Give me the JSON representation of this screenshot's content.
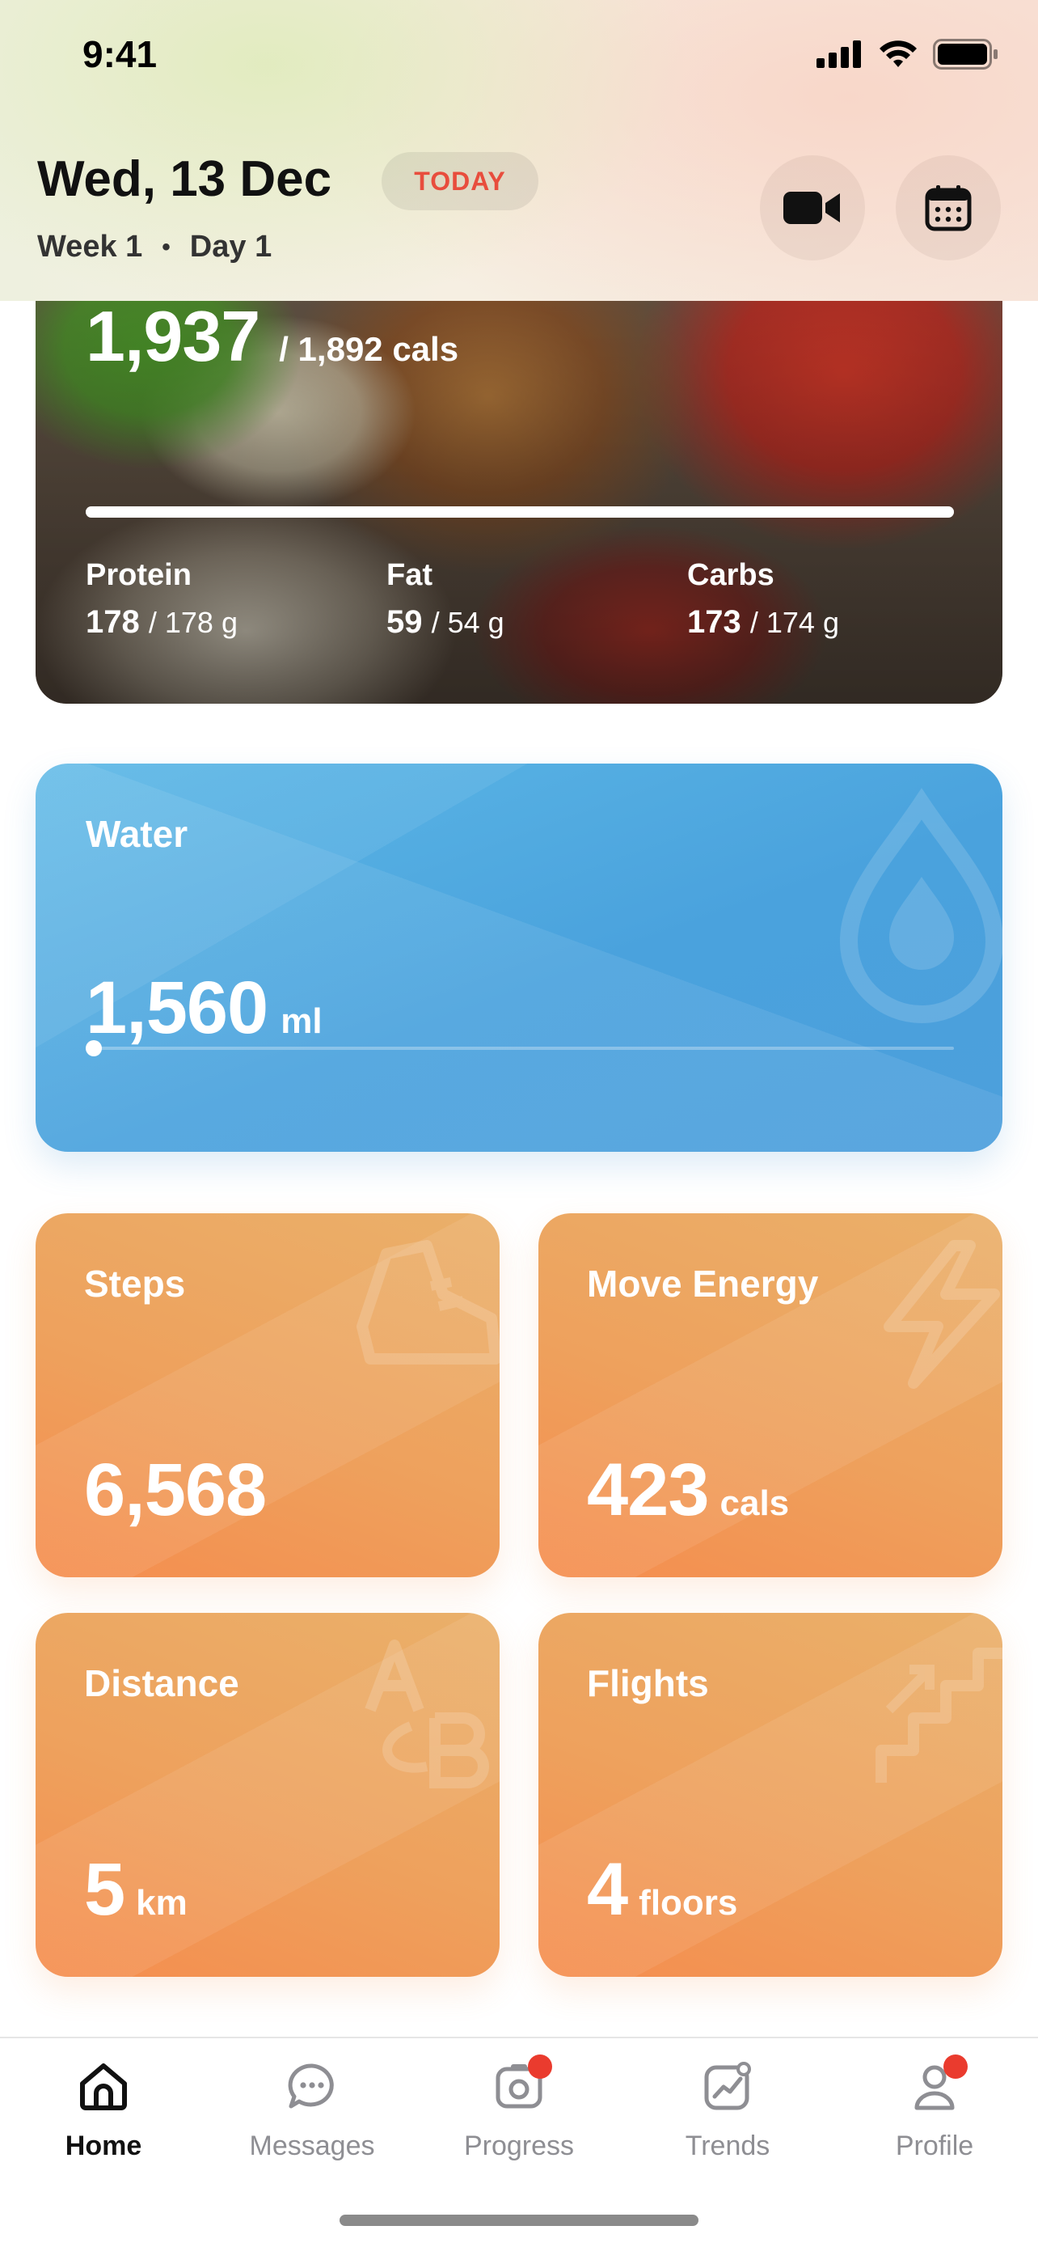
{
  "status_bar": {
    "time": "9:41"
  },
  "header": {
    "date": "Wed, 13 Dec",
    "badge": "TODAY",
    "week": "Week 1",
    "day": "Day 1",
    "dot": "•",
    "video_button_icon": "video-camera-icon",
    "calendar_button_icon": "calendar-icon"
  },
  "nutrition": {
    "calories_consumed": "1,937",
    "calories_goal_text": "/ 1,892 cals",
    "progress_fraction": 1.0,
    "macros": [
      {
        "label": "Protein",
        "value": "178",
        "goal": "/ 178 g"
      },
      {
        "label": "Fat",
        "value": "59",
        "goal": "/ 54 g"
      },
      {
        "label": "Carbs",
        "value": "173",
        "goal": "/ 174 g"
      }
    ]
  },
  "water": {
    "title": "Water",
    "value": "1,560",
    "unit": "ml",
    "progress_fraction": 0.0,
    "icon": "water-drop-icon"
  },
  "activity": [
    {
      "title": "Steps",
      "value": "6,568",
      "unit": "",
      "icon": "sneaker-icon"
    },
    {
      "title": "Move Energy",
      "value": "423",
      "unit": "cals",
      "icon": "lightning-icon"
    },
    {
      "title": "Distance",
      "value": "5",
      "unit": "km",
      "icon": "a-to-b-icon"
    },
    {
      "title": "Flights",
      "value": "4",
      "unit": "floors",
      "icon": "stairs-icon"
    }
  ],
  "tabs": [
    {
      "label": "Home",
      "icon": "home-icon",
      "active": true,
      "badge": false
    },
    {
      "label": "Messages",
      "icon": "chat-bubble-icon",
      "active": false,
      "badge": false
    },
    {
      "label": "Progress",
      "icon": "camera-progress-icon",
      "active": false,
      "badge": true
    },
    {
      "label": "Trends",
      "icon": "trend-chart-icon",
      "active": false,
      "badge": false
    },
    {
      "label": "Profile",
      "icon": "user-icon",
      "active": false,
      "badge": true
    }
  ],
  "colors": {
    "accent_red": "#e84d3d",
    "water_blue": "#4aa2dd",
    "activity_orange": "#eea15d",
    "badge_red": "#ea3b2e"
  }
}
